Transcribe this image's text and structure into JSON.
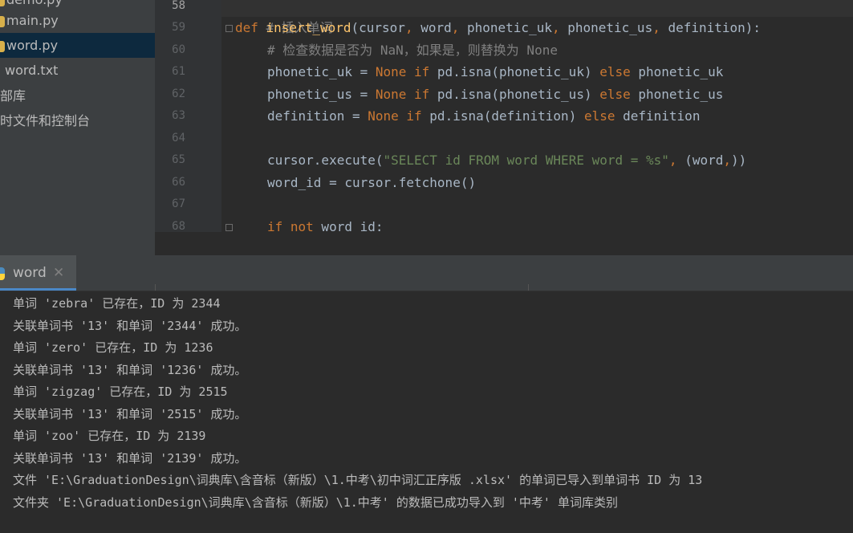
{
  "sidebar": {
    "items": [
      {
        "label": "demo.py",
        "icon": "python-file-icon",
        "selected": false
      },
      {
        "label": "main.py",
        "icon": "python-file-icon",
        "selected": false
      },
      {
        "label": "word.py",
        "icon": "python-file-icon",
        "selected": true
      },
      {
        "label": "word.txt",
        "icon": "text-file-icon",
        "selected": false
      },
      {
        "label": "部库",
        "icon": "",
        "selected": false
      },
      {
        "label": "时文件和控制台",
        "icon": "",
        "selected": false
      }
    ]
  },
  "editor": {
    "line_numbers": [
      "58",
      "59",
      "60",
      "61",
      "62",
      "63",
      "64",
      "65",
      "66",
      "67",
      "68"
    ],
    "lines": {
      "l58": "# 插入单词",
      "l59_def": "def ",
      "l59_name": "insert_word",
      "l59_open": "(cursor",
      "l59_c1": ", ",
      "l59_word": "word",
      "l59_c2": ", ",
      "l59_uk": "phonetic_uk",
      "l59_c3": ", ",
      "l59_us": "phonetic_us",
      "l59_c4": ", ",
      "l59_defn": "definition):",
      "l60": "# 检查数据是否为 NaN，如果是，则替换为 None",
      "l61_a": "phonetic_uk = ",
      "l61_none": "None",
      "l61_if": " if ",
      "l61_b": "pd.isna(phonetic_uk) ",
      "l61_else": "else",
      "l61_c": " phonetic_uk",
      "l62_a": "phonetic_us = ",
      "l62_none": "None",
      "l62_if": " if ",
      "l62_b": "pd.isna(phonetic_us) ",
      "l62_else": "else",
      "l62_c": " phonetic_us",
      "l63_a": "definition = ",
      "l63_none": "None",
      "l63_if": " if ",
      "l63_b": "pd.isna(definition) ",
      "l63_else": "else",
      "l63_c": " definition",
      "l65_a": "cursor.execute(",
      "l65_str": "\"SELECT id FROM word WHERE word = %s\"",
      "l65_comma": ", ",
      "l65_b": "(word",
      "l65_comma2": ",",
      "l65_c": "))",
      "l66": "word_id = cursor.fetchone()",
      "l68_if": "if not",
      "l68_rest": " word_id:"
    }
  },
  "run_panel": {
    "tab_label": "word",
    "tab_close": "✕"
  },
  "console": {
    "lines": [
      "单词 'zebra' 已存在，ID 为 2344",
      "关联单词书 '13' 和单词 '2344' 成功。",
      "单词 'zero' 已存在，ID 为 1236",
      "关联单词书 '13' 和单词 '1236' 成功。",
      "单词 'zigzag' 已存在，ID 为 2515",
      "关联单词书 '13' 和单词 '2515' 成功。",
      "单词 'zoo' 已存在，ID 为 2139",
      "关联单词书 '13' 和单词 '2139' 成功。",
      "文件 'E:\\GraduationDesign\\词典库\\含音标（新版）\\1.中考\\初中词汇正序版 .xlsx' 的单词已导入到单词书 ID 为 13",
      "文件夹 'E:\\GraduationDesign\\词典库\\含音标（新版）\\1.中考' 的数据已成功导入到 '中考' 单词库类别"
    ]
  },
  "colors": {
    "background": "#2b2b2b",
    "sidebar": "#3c3f41",
    "selection": "#0d293e",
    "keyword": "#cc7832",
    "function": "#ffc66d",
    "string": "#6a8759",
    "comment": "#808080",
    "text": "#a9b7c6"
  }
}
